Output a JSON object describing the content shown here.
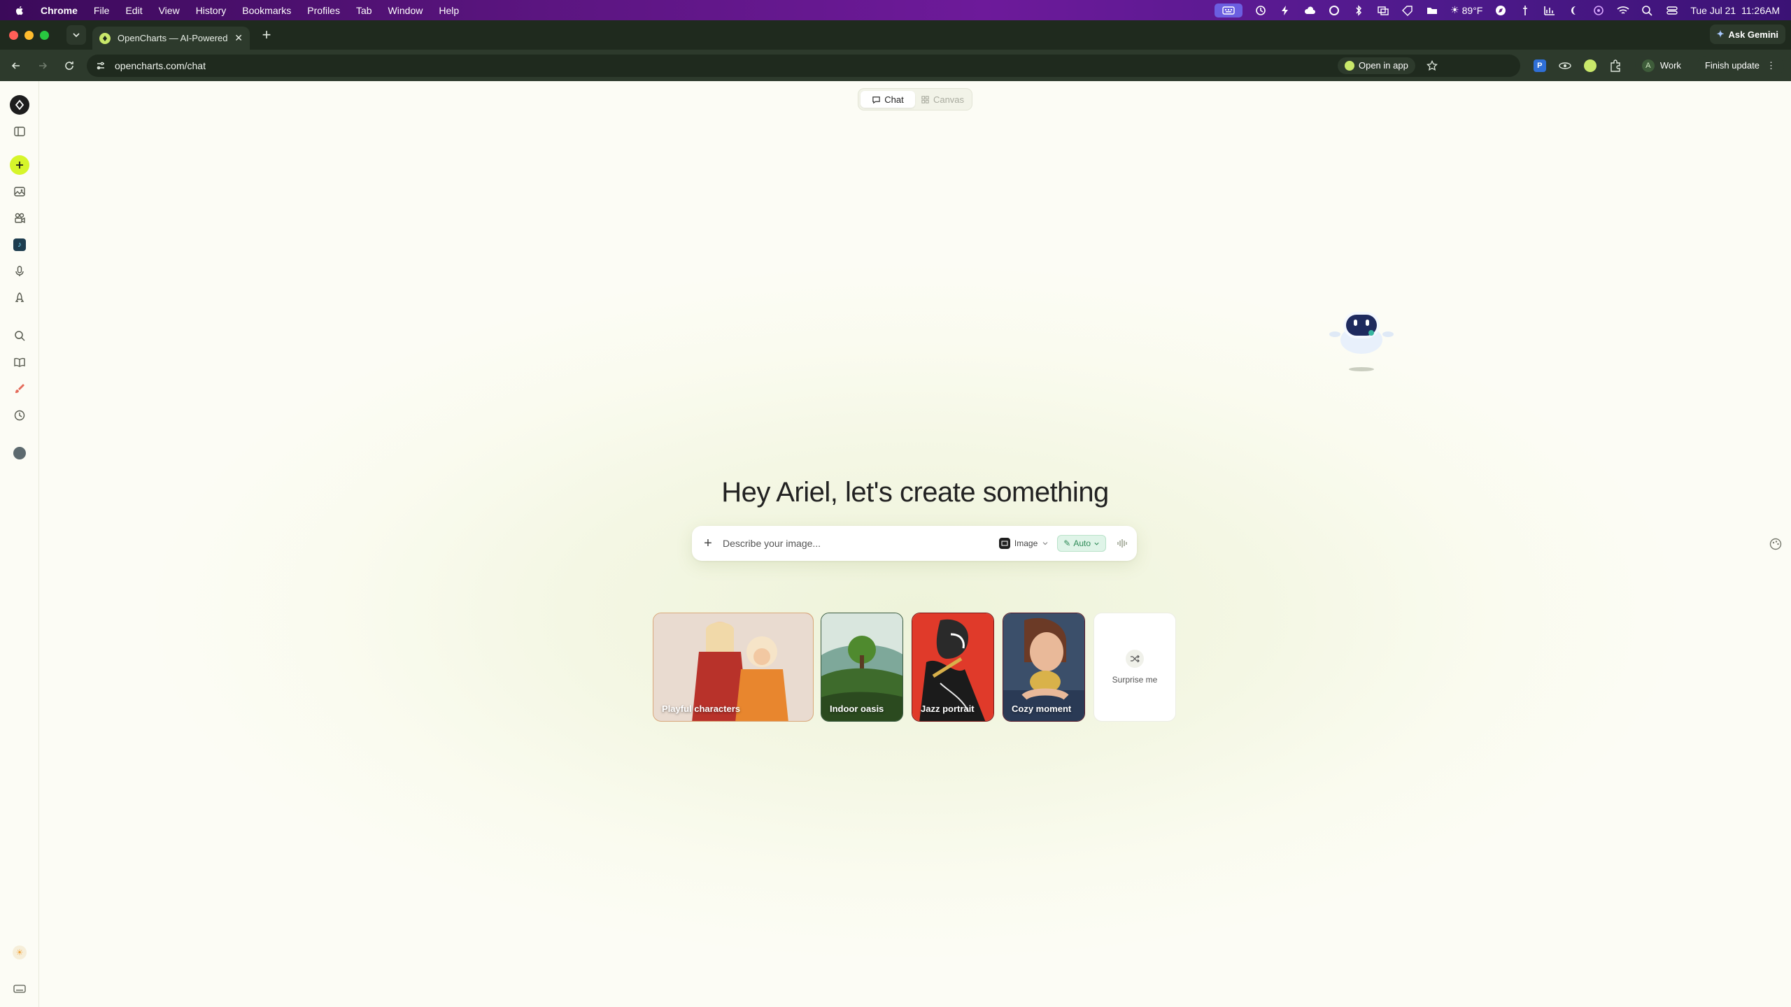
{
  "menubar": {
    "app": "Chrome",
    "items": [
      "File",
      "Edit",
      "View",
      "History",
      "Bookmarks",
      "Profiles",
      "Tab",
      "Window",
      "Help"
    ],
    "weather": "89°F",
    "datetime": "Tue Jul 21  11:26AM"
  },
  "browser": {
    "tab_title": "OpenCharts — AI-Powered F",
    "url": "opencharts.com/chat",
    "open_in_app": "Open in app",
    "ask_gemini": "Ask Gemini",
    "profile_initial": "A",
    "profile_name": "Work",
    "finish_update": "Finish update"
  },
  "page": {
    "mode_tabs": [
      {
        "label": "Chat",
        "active": true
      },
      {
        "label": "Canvas",
        "active": false
      }
    ],
    "headline": "Hey Ariel, let's create something",
    "prompt": {
      "placeholder": "Describe your image...",
      "type_label": "Image",
      "auto_label": "Auto"
    },
    "cards": [
      {
        "label": "Playful characters"
      },
      {
        "label": "Indoor oasis"
      },
      {
        "label": "Jazz portrait"
      },
      {
        "label": "Cozy moment"
      },
      {
        "label": "Surprise me"
      }
    ]
  },
  "colors": {
    "accent_new_button": "#d6f52a",
    "auto_chip": "#dff4e8"
  }
}
